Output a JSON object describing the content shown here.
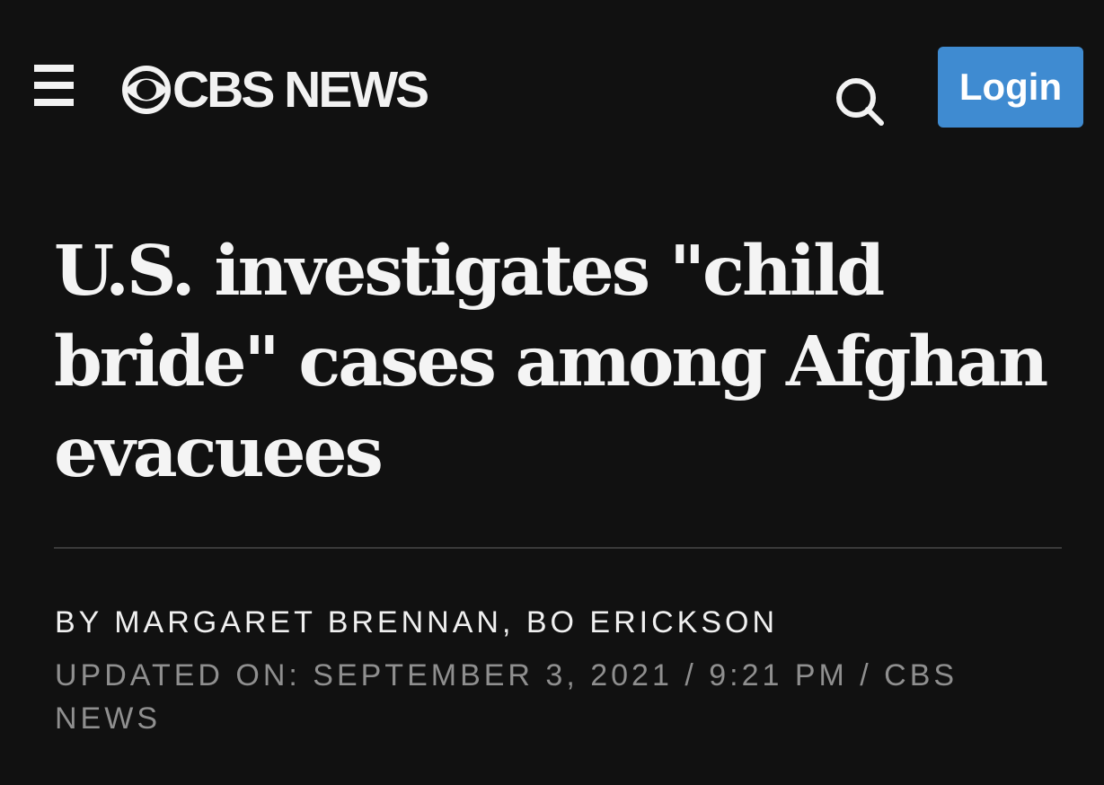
{
  "header": {
    "menu_icon": "hamburger-menu-icon",
    "brand_text": "CBS NEWS",
    "brand_icon": "cbs-eye-icon",
    "search_icon": "search-icon",
    "login_label": "Login",
    "login_color": "#3f8bd1"
  },
  "article": {
    "headline": "U.S. investigates \"child bride\" cases among Afghan evacuees",
    "byline": "BY MARGARET BRENNAN, BO ERICKSON",
    "dateline": "UPDATED ON: SEPTEMBER 3, 2021 / 9:21 PM / CBS NEWS"
  },
  "colors": {
    "background": "#111111",
    "text": "#f2f2f2",
    "muted_text": "#8f8f8f"
  }
}
